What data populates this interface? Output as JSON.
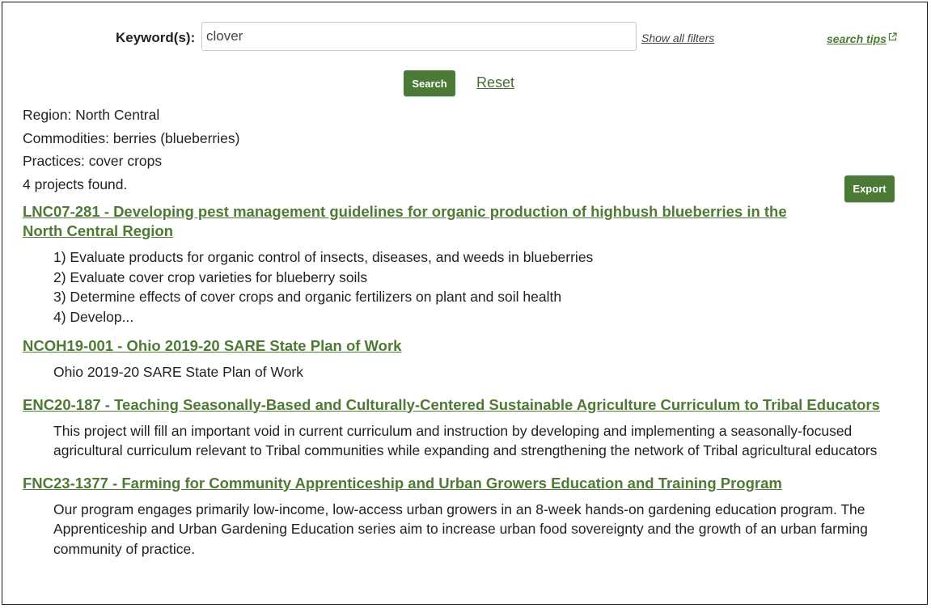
{
  "search": {
    "keyword_label": "Keyword(s):",
    "keyword_value": "clover",
    "show_filters_label": "Show all filters",
    "tips_label": "search tips",
    "search_button_label": "Search",
    "reset_label": "Reset"
  },
  "filters": [
    "Region: North Central",
    "Commodities: berries (blueberries)",
    "Practices: cover crops"
  ],
  "results_count": "4 projects found.",
  "export_label": "Export",
  "results": [
    {
      "title": "LNC07-281 - Developing pest management guidelines for organic production of highbush blueberries in the North Central Region",
      "lines": [
        "1) Evaluate products for organic control of insects, diseases, and weeds in blueberries",
        "2) Evaluate cover crop varieties for blueberry soils",
        "3) Determine effects of cover crops and organic fertilizers on plant and soil health",
        "4) Develop..."
      ]
    },
    {
      "title": "NCOH19-001 - Ohio 2019-20 SARE State Plan of Work",
      "description": "Ohio 2019-20 SARE State Plan of Work"
    },
    {
      "title": "ENC20-187 - Teaching Seasonally-Based and Culturally-Centered Sustainable Agriculture Curriculum to Tribal Educators",
      "description": "This project will fill an important void in current curriculum and instruction by developing and implementing a seasonally-focused agricultural curriculum relevant to Tribal communities while expanding and strengthening the network of Tribal agricultural educators"
    },
    {
      "title": "FNC23-1377 - Farming for Community Apprenticeship and Urban Growers Education and Training Program",
      "description": "Our program engages primarily low-income, low-access urban growers in an 8-week hands-on gardening education program. The Apprenticeship and Urban Gardening Education series aim to increase urban food sovereignty and the growth of an urban farming community of practice."
    }
  ],
  "colors": {
    "accent_green": "#4a7a35",
    "link_green": "#4e7a34"
  }
}
